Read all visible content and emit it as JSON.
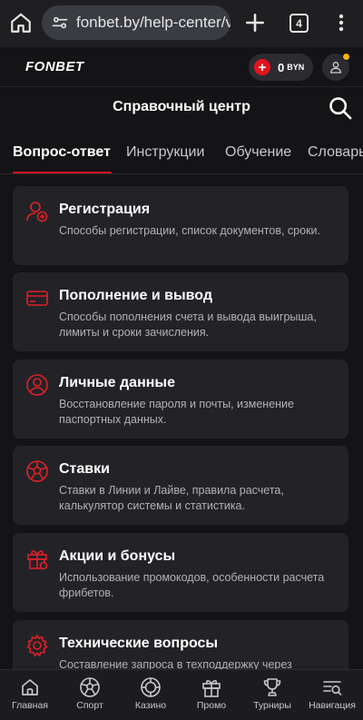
{
  "browser": {
    "url": "fonbet.by/help-center/v",
    "tab_count": "4"
  },
  "header": {
    "logo": "FONBET",
    "balance_amount": "0",
    "balance_currency": "BYN"
  },
  "page": {
    "title": "Справочный центр"
  },
  "tabs": [
    {
      "label": "Вопрос-ответ",
      "active": true
    },
    {
      "label": "Инструкции",
      "active": false
    },
    {
      "label": "Обучение",
      "active": false
    },
    {
      "label": "Словарь",
      "active": false
    }
  ],
  "cards": [
    {
      "title": "Регистрация",
      "description": "Способы регистрации, список документов, сроки.",
      "icon": "user-add-icon"
    },
    {
      "title": "Пополнение и вывод",
      "description": "Способы пополнения счета и вывода выигрыша, лимиты и сроки зачисления.",
      "icon": "card-icon"
    },
    {
      "title": "Личные данные",
      "description": "Восстановление пароля и почты, изменение паспортных данных.",
      "icon": "person-icon"
    },
    {
      "title": "Ставки",
      "description": "Ставки в Линии и Лайве, правила расчета, калькулятор системы и статистика.",
      "icon": "ball-icon"
    },
    {
      "title": "Акции и бонусы",
      "description": "Использование промокодов, особенности расчета фрибетов.",
      "icon": "gift-icon"
    },
    {
      "title": "Технические вопросы",
      "description": "Составление запроса в техподдержку через",
      "icon": "gear-icon"
    }
  ],
  "bottom_nav": [
    {
      "label": "Главная",
      "icon": "home-icon"
    },
    {
      "label": "Спорт",
      "icon": "ball-icon"
    },
    {
      "label": "Казино",
      "icon": "chip-icon"
    },
    {
      "label": "Промо",
      "icon": "gift-icon"
    },
    {
      "label": "Турниры",
      "icon": "trophy-icon"
    },
    {
      "label": "Навигация",
      "icon": "navigation-icon"
    }
  ],
  "colors": {
    "accent": "#d6121c",
    "background": "#141416",
    "card": "#232327"
  }
}
